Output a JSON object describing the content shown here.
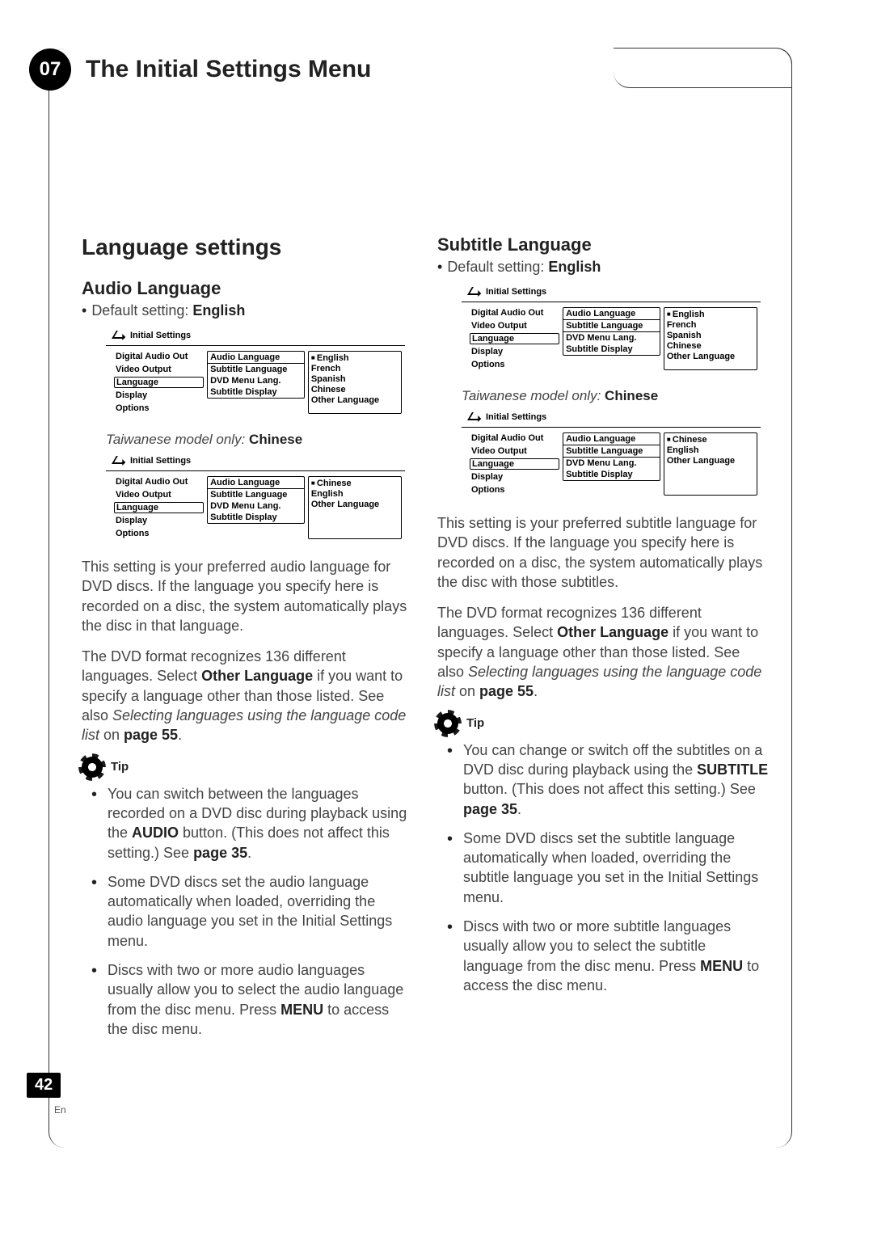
{
  "chapter": {
    "number": "07",
    "title": "The Initial Settings Menu"
  },
  "page": {
    "number": "42",
    "lang": "En"
  },
  "left": {
    "h1": "Language settings",
    "h2": "Audio Language",
    "default": {
      "label": "Default setting:",
      "value": "English"
    },
    "osd1": {
      "title": "Initial Settings",
      "leftItems": [
        "Digital Audio Out",
        "Video Output",
        "Language",
        "Display",
        "Options"
      ],
      "leftSelectedIndex": 2,
      "midItems": [
        "Audio Language",
        "Subtitle Language",
        "DVD Menu Lang.",
        "Subtitle Display"
      ],
      "midHighlightIndex": 0,
      "rightItems": [
        "English",
        "French",
        "Spanish",
        "Chinese",
        "Other Language"
      ],
      "rightMarkIndex": 0
    },
    "note": {
      "prefix": "Taiwanese model only:",
      "value": "Chinese"
    },
    "osd2": {
      "title": "Initial Settings",
      "leftItems": [
        "Digital Audio Out",
        "Video Output",
        "Language",
        "Display",
        "Options"
      ],
      "leftSelectedIndex": 2,
      "midItems": [
        "Audio Language",
        "Subtitle Language",
        "DVD Menu Lang.",
        "Subtitle Display"
      ],
      "midHighlightIndex": 0,
      "rightItems": [
        "Chinese",
        "English",
        "Other Language"
      ],
      "rightMarkIndex": 0
    },
    "p1_a": "This setting is your preferred audio language for DVD discs. If the language you specify here is recorded on a disc, the system automatically plays the disc in that language.",
    "p2_a": "The DVD format recognizes 136 different languages. Select ",
    "p2_b": "Other Language",
    "p2_c": " if you want to specify a language other than those listed. See also ",
    "p2_d": "Selecting languages using the language code list",
    "p2_e": " on ",
    "p2_f": "page 55",
    "p2_g": ".",
    "tipLabel": "Tip",
    "tips": [
      {
        "a": "You can switch between the languages recorded on a DVD disc during playback using the ",
        "b": "AUDIO",
        "c": " button. (This does not affect this setting.) See ",
        "d": "page 35",
        "e": "."
      },
      {
        "a": "Some DVD discs set the audio language automatically when loaded, overriding the audio language you set in the Initial Settings menu."
      },
      {
        "a": "Discs with two or more audio languages usually allow you to select the audio language from the disc menu. Press ",
        "b": "MENU",
        "c": " to access the disc menu."
      }
    ]
  },
  "right": {
    "h2": "Subtitle Language",
    "default": {
      "label": "Default setting:",
      "value": "English"
    },
    "osd1": {
      "title": "Initial Settings",
      "leftItems": [
        "Digital Audio Out",
        "Video Output",
        "Language",
        "Display",
        "Options"
      ],
      "leftSelectedIndex": 2,
      "midItems": [
        "Audio Language",
        "Subtitle Language",
        "DVD Menu Lang.",
        "Subtitle Display"
      ],
      "midHighlightIndex": 1,
      "rightItems": [
        "English",
        "French",
        "Spanish",
        "Chinese",
        "Other Language"
      ],
      "rightMarkIndex": 0
    },
    "note": {
      "prefix": "Taiwanese model only:",
      "value": "Chinese"
    },
    "osd2": {
      "title": "Initial Settings",
      "leftItems": [
        "Digital Audio Out",
        "Video Output",
        "Language",
        "Display",
        "Options"
      ],
      "leftSelectedIndex": 2,
      "midItems": [
        "Audio Language",
        "Subtitle Language",
        "DVD Menu Lang.",
        "Subtitle Display"
      ],
      "midHighlightIndex": 1,
      "rightItems": [
        "Chinese",
        "English",
        "Other Language"
      ],
      "rightMarkIndex": 0
    },
    "p1_a": "This setting is your preferred subtitle language for DVD discs. If the language you specify here is recorded on a disc, the system automatically plays the disc with those subtitles.",
    "p2_a": "The DVD format recognizes 136 different languages. Select ",
    "p2_b": "Other Language",
    "p2_c": " if you want to specify a language other than those listed. See also ",
    "p2_d": "Selecting languages using the language code list",
    "p2_e": " on ",
    "p2_f": "page 55",
    "p2_g": ".",
    "tipLabel": "Tip",
    "tips": [
      {
        "a": "You can change or switch off the subtitles on a DVD disc during playback using the ",
        "b": "SUBTITLE",
        "c": " button. (This does not affect this setting.) See ",
        "d": "page 35",
        "e": "."
      },
      {
        "a": "Some DVD discs set the subtitle language automatically when loaded, overriding the subtitle language you set in the Initial Settings menu."
      },
      {
        "a": "Discs with two or more subtitle languages usually allow you to select the subtitle language from the disc menu. Press ",
        "b": "MENU",
        "c": " to access the disc menu."
      }
    ]
  }
}
